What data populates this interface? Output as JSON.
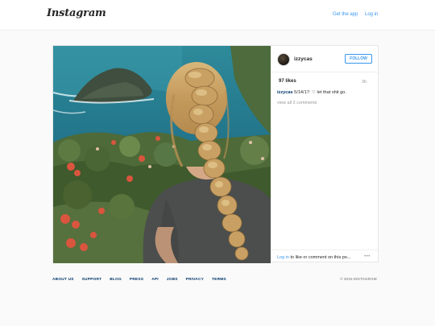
{
  "header": {
    "logo": "Instagram",
    "get_app": "Get the app",
    "login": "Log in"
  },
  "post": {
    "username": "izzycas",
    "follow_label": "FOLLOW",
    "likes": "97 likes",
    "time": "3h",
    "caption_user": "izzycas",
    "caption_text": "5/14/17: ♡ let that shit go.",
    "view_all": "view all 3 comments",
    "footer_login": "Log in",
    "footer_text": " to like or comment on this po...",
    "more": "•••"
  },
  "footer": {
    "links": [
      "ABOUT US",
      "SUPPORT",
      "BLOG",
      "PRESS",
      "API",
      "JOBS",
      "PRIVACY",
      "TERMS"
    ],
    "copyright": "© 2015 INSTAGRAM"
  },
  "colors": {
    "link_blue": "#3897f0",
    "dark_link": "#003569",
    "muted": "#999999"
  },
  "icons": [
    "avatar-image",
    "more-options-icon"
  ]
}
